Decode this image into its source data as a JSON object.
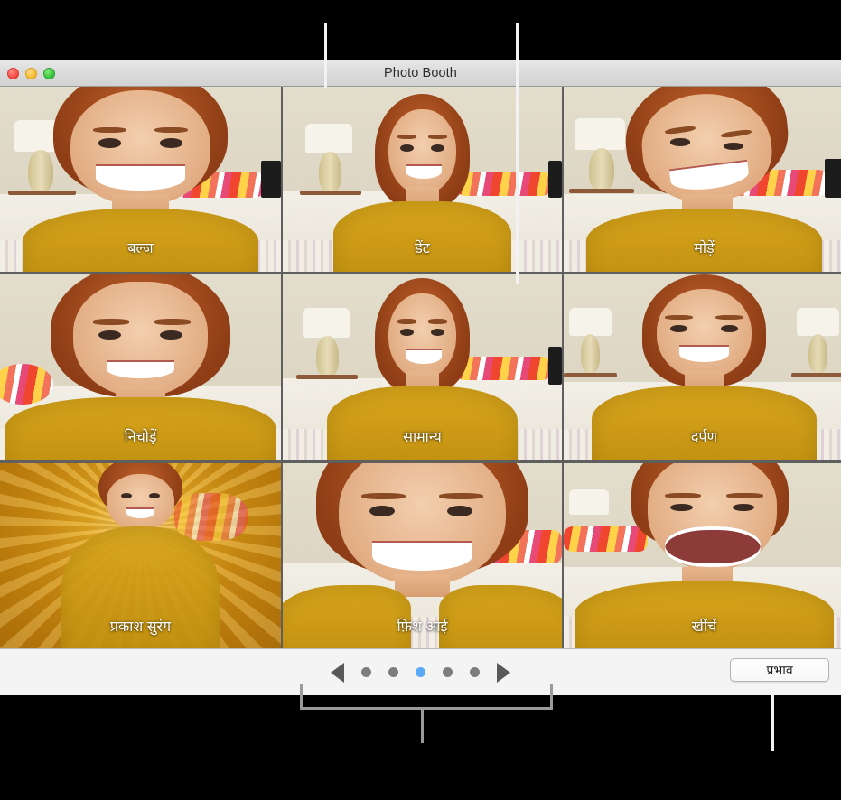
{
  "window": {
    "title": "Photo Booth",
    "traffic_lights": [
      "close-button",
      "minimize-button",
      "maximize-button"
    ]
  },
  "effects_grid": {
    "columns": 3,
    "rows": 3,
    "selected_index": 4,
    "tiles": [
      {
        "label": "बल्ज",
        "effect": "bulge",
        "selected": false
      },
      {
        "label": "डेंट",
        "effect": "dent",
        "selected": false
      },
      {
        "label": "मोड़ें",
        "effect": "twirl",
        "selected": false
      },
      {
        "label": "निचोड़ें",
        "effect": "squeeze",
        "selected": false
      },
      {
        "label": "सामान्य",
        "effect": "normal",
        "selected": true
      },
      {
        "label": "दर्पण",
        "effect": "mirror",
        "selected": false
      },
      {
        "label": "प्रकाश सुरंग",
        "effect": "light-tunnel",
        "selected": false
      },
      {
        "label": "फ़िश आई",
        "effect": "fish-eye",
        "selected": false
      },
      {
        "label": "खींचें",
        "effect": "stretch",
        "selected": false
      }
    ]
  },
  "toolbar": {
    "previous_icon": "triangle-left-icon",
    "next_icon": "triangle-right-icon",
    "page_dots": 5,
    "active_page": 3,
    "effects_button_label": "प्रभाव"
  },
  "annotations": {
    "callout_top_left": "pointer-line-to-grid",
    "callout_top_right": "pointer-line-to-selected-tile",
    "callout_bottom_bracket": "bracket-to-page-controls",
    "callout_bottom_right": "pointer-line-to-effects-button"
  },
  "colors": {
    "accent_dot": "#5aa9f7",
    "grid_background": "#5f5f5f",
    "toolbar_background": "#f4f4f4",
    "callout_line": "#f2f2f2"
  }
}
